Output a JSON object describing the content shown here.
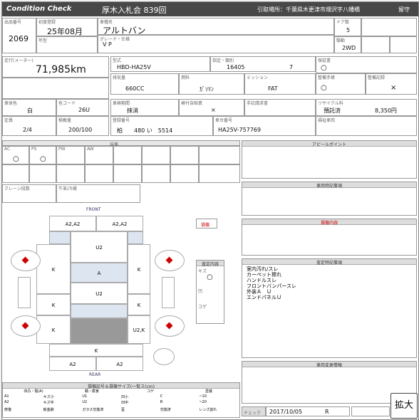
{
  "header": {
    "title": "Condition Check",
    "auction": "厚木入札会 839回",
    "location": "引取場所：千葉県木更津市畑沢字八幡橋",
    "corner": "留守"
  },
  "lbl": {
    "lot_no": "出品番号",
    "first_reg": "初度登録",
    "car_name": "車種名",
    "doors": "ドア数",
    "model_year": "年型",
    "grade": "グレード・仕様",
    "seats": "駆動",
    "mileage": "走行(メーター)",
    "model": "型式",
    "designation": "指定・類別",
    "warranty": "保証書",
    "displacement": "排気量",
    "fuel": "燃料",
    "mission": "ミッション",
    "manual": "整備手帳",
    "record": "整備記録",
    "color": "車体色",
    "color_code": "色コード",
    "inspection_period": "車検期間",
    "auto_inspection": "検付自賠責",
    "manual_doc": "手記請求書",
    "recycle": "リサイクル料",
    "capacity": "定員",
    "load": "積載量",
    "reg_no": "登録番号",
    "chassis": "車台番号",
    "welfare": "福祉車両",
    "equipment": "装備",
    "crane": "クレーン段数",
    "seat_belt": "牛革/冷蔵",
    "appeal": "アピールポイント",
    "special": "車両特記事項",
    "defect": "損傷内容",
    "inspection_notes": "査定特記事項",
    "replacement": "車両変更情報",
    "check": "チェック",
    "front": "FRONT",
    "rear": "REAR",
    "mark": "損傷",
    "legend_title": "損傷記号＆損傷サイズ(一覧ス(cm)",
    "ins_label": "査定内容",
    "ins_scratch": "キズ",
    "ins_dent": "凹",
    "ins_rust": "コゲ"
  },
  "vals": {
    "lot_no": "2069",
    "first_reg": "25年08月",
    "car_name": "アルトバン",
    "doors": "5",
    "grade": "V P",
    "seats": "2WD",
    "mileage": "71,985km",
    "model": "HBD-HA25V",
    "designation": "16405",
    "class": "7",
    "warranty": "○",
    "displacement": "660CC",
    "fuel": "ｶﾞｿﾘﾝ",
    "mission": "FAT",
    "manual": "○",
    "record": "×",
    "color": "白",
    "color_code": "26U",
    "inspection_period": "抹消",
    "auto_inspection": "×",
    "recycle": "預託済",
    "recycle_fee": "8,350円",
    "capacity": "2/4",
    "load": "200/100",
    "reg_no": "柏　　480 い　5514",
    "chassis": "HA25V-757769",
    "check_date": "2017/10/05",
    "check_grade": "R"
  },
  "equip": {
    "ac": "AC",
    "ps": "PS",
    "pw": "PW",
    "aw": "AW",
    "ac_v": "○",
    "ps_v": "○"
  },
  "panels": [
    "A2,A2",
    "A2,A2",
    "U2",
    "K",
    "A",
    "K",
    "U2",
    "K",
    "K",
    "K",
    "U2,K",
    "K",
    "A2",
    "A2"
  ],
  "notes": [
    "室内汚れ/スレ",
    "カーペット擦れ",
    "ハンドルスレ",
    "フロントバンパースレ",
    "外装Ａ　Ｕ",
    "エンドパネルＵ"
  ],
  "legend": {
    "h1": "凹凸・傷(A)",
    "h2": "錆・腐食",
    "h3": "コゲ",
    "h4": "塗装",
    "rows": [
      [
        "A1",
        "キズ小",
        "U1",
        "凹小",
        "C",
        "~10"
      ],
      [
        "A2",
        "キズ中",
        "U2",
        "凹中",
        "B",
        "~20"
      ]
    ],
    "r3": [
      "修復",
      "板金跡",
      "ガラス交換済",
      "歪",
      "交換済",
      "レンズ割れ"
    ]
  },
  "expand": "拡大",
  "colors": {
    "header": "#484848",
    "damage": "#cc0000",
    "panel_blue": "#dde6f0"
  }
}
